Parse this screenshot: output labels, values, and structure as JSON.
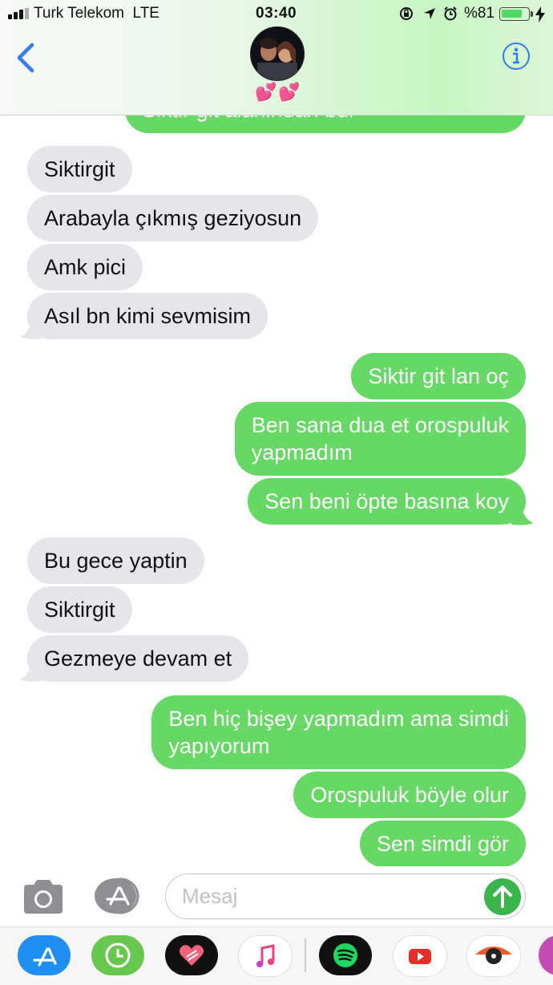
{
  "status_bar": {
    "carrier": "Turk Telekom",
    "network": "LTE",
    "time": "03:40",
    "battery_percent": "%81",
    "battery_level": 0.81,
    "icons": [
      "signal-icon",
      "orientation-lock-icon",
      "location-icon",
      "alarm-icon",
      "battery-icon",
      "charging-icon"
    ]
  },
  "header": {
    "back_icon": "chevron-left-icon",
    "contact_name": "💕💕",
    "info_icon": "info-icon"
  },
  "messages": [
    {
      "side": "out",
      "text": "Siktir git alanindan bul"
    },
    {
      "side": "in",
      "text": "Siktirgit"
    },
    {
      "side": "in",
      "text": "Arabayla çıkmış geziyosun"
    },
    {
      "side": "in",
      "text": "Amk pici"
    },
    {
      "side": "in",
      "text": "Asıl bn kimi sevmisim"
    },
    {
      "side": "out",
      "text": "Siktir git lan oç"
    },
    {
      "side": "out",
      "text": "Ben sana dua et orospuluk\nyapmadım"
    },
    {
      "side": "out",
      "text": "Sen beni öpte basına koy"
    },
    {
      "side": "in",
      "text": "Bu gece yaptin"
    },
    {
      "side": "in",
      "text": "Siktirgit"
    },
    {
      "side": "in",
      "text": "Gezmeye devam et"
    },
    {
      "side": "out",
      "text": "Ben hiç bişey yapmadım ama simdi\nyapıyorum"
    },
    {
      "side": "out",
      "text": "Orospuluk böyle olur"
    },
    {
      "side": "out",
      "text": "Sen simdi gör"
    }
  ],
  "input_bar": {
    "camera_icon": "camera-icon",
    "apps_icon": "app-store-icon",
    "placeholder": "Mesaj",
    "send_icon": "send-arrow-icon"
  },
  "app_drawer": [
    {
      "icon": "app-store-icon",
      "color": "#1a8cf0"
    },
    {
      "icon": "clock-icon",
      "color": "#65c94d"
    },
    {
      "icon": "heart-image-icon",
      "color": "#111111"
    },
    {
      "icon": "music-note-icon",
      "color": "#ffffff"
    },
    {
      "icon": "spotify-icon",
      "color": "#111111"
    },
    {
      "icon": "youtube-icon",
      "color": "#ffffff"
    },
    {
      "icon": "camera-eye-icon",
      "color": "#ffffff"
    },
    {
      "icon": "partial-app-icon",
      "color": "#c44bb4"
    }
  ],
  "colors": {
    "outgoing_bubble": "#65d964",
    "incoming_bubble": "#e5e5ea",
    "accent": "#2f7cf6"
  }
}
